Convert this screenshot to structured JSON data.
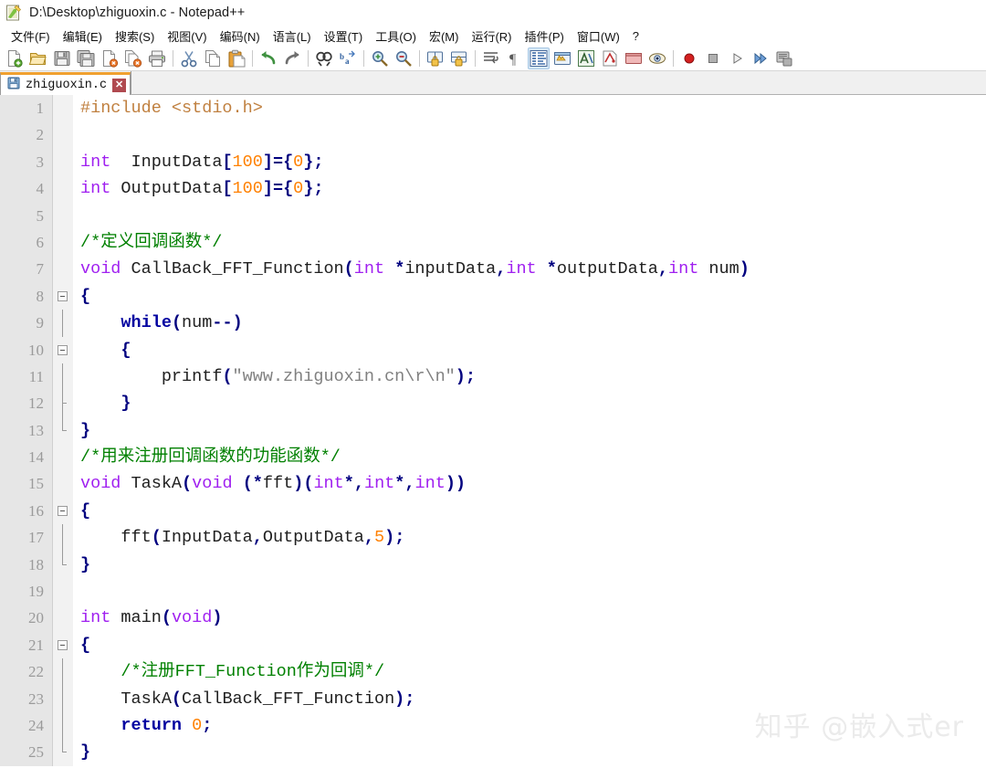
{
  "window": {
    "title": "D:\\Desktop\\zhiguoxin.c - Notepad++",
    "app_icon": "notepad-plus-plus-icon"
  },
  "menubar": {
    "items": [
      {
        "label": "文件(F)",
        "name": "menu-file"
      },
      {
        "label": "编辑(E)",
        "name": "menu-edit"
      },
      {
        "label": "搜索(S)",
        "name": "menu-search"
      },
      {
        "label": "视图(V)",
        "name": "menu-view"
      },
      {
        "label": "编码(N)",
        "name": "menu-encoding"
      },
      {
        "label": "语言(L)",
        "name": "menu-language"
      },
      {
        "label": "设置(T)",
        "name": "menu-settings"
      },
      {
        "label": "工具(O)",
        "name": "menu-tools"
      },
      {
        "label": "宏(M)",
        "name": "menu-macro"
      },
      {
        "label": "运行(R)",
        "name": "menu-run"
      },
      {
        "label": "插件(P)",
        "name": "menu-plugins"
      },
      {
        "label": "窗口(W)",
        "name": "menu-window"
      },
      {
        "label": "?",
        "name": "menu-help"
      }
    ]
  },
  "toolbar": {
    "buttons": [
      "new-file-icon",
      "open-file-icon",
      "save-icon",
      "save-all-icon",
      "close-file-icon",
      "close-all-icon",
      "print-icon",
      "sep",
      "cut-icon",
      "copy-icon",
      "paste-icon",
      "sep",
      "undo-icon",
      "redo-icon",
      "sep",
      "find-icon",
      "replace-icon",
      "sep",
      "zoom-in-icon",
      "zoom-out-icon",
      "sep",
      "sync-vertical-scroll-icon",
      "sync-horizontal-scroll-icon",
      "sep",
      "word-wrap-icon",
      "show-all-characters-icon",
      "indent-guide-icon",
      "user-defined-dialog-icon",
      "show-function-list-icon",
      "document-map-icon",
      "folder-as-workspace-icon",
      "monitoring-icon",
      "sep",
      "macro-record-icon",
      "macro-stop-icon",
      "macro-playback-icon",
      "macro-run-multiple-icon",
      "macro-save-icon"
    ]
  },
  "tab": {
    "label": "zhiguoxin.c",
    "save_icon": "floppy-disk-saved-icon",
    "close_label": "✕"
  },
  "editor": {
    "first_line": 1,
    "last_line": 25,
    "lines": [
      {
        "n": "1",
        "fold": "none"
      },
      {
        "n": "2",
        "fold": "none"
      },
      {
        "n": "3",
        "fold": "none"
      },
      {
        "n": "4",
        "fold": "none"
      },
      {
        "n": "5",
        "fold": "none"
      },
      {
        "n": "6",
        "fold": "none"
      },
      {
        "n": "7",
        "fold": "none"
      },
      {
        "n": "8",
        "fold": "open"
      },
      {
        "n": "9",
        "fold": "line"
      },
      {
        "n": "10",
        "fold": "open"
      },
      {
        "n": "11",
        "fold": "line"
      },
      {
        "n": "12",
        "fold": "tick"
      },
      {
        "n": "13",
        "fold": "end"
      },
      {
        "n": "14",
        "fold": "none"
      },
      {
        "n": "15",
        "fold": "none"
      },
      {
        "n": "16",
        "fold": "open"
      },
      {
        "n": "17",
        "fold": "line"
      },
      {
        "n": "18",
        "fold": "end"
      },
      {
        "n": "19",
        "fold": "none"
      },
      {
        "n": "20",
        "fold": "none"
      },
      {
        "n": "21",
        "fold": "open"
      },
      {
        "n": "22",
        "fold": "line"
      },
      {
        "n": "23",
        "fold": "line"
      },
      {
        "n": "24",
        "fold": "line"
      },
      {
        "n": "25",
        "fold": "end"
      }
    ],
    "code": [
      [
        {
          "t": "#include ",
          "c": "pp"
        },
        {
          "t": "<stdio.h>",
          "c": "pp"
        }
      ],
      [],
      [
        {
          "t": "int",
          "c": "k"
        },
        {
          "t": "  InputData",
          "c": "id"
        },
        {
          "t": "[",
          "c": "op"
        },
        {
          "t": "100",
          "c": "num"
        },
        {
          "t": "]={",
          "c": "op"
        },
        {
          "t": "0",
          "c": "num"
        },
        {
          "t": "};",
          "c": "op"
        }
      ],
      [
        {
          "t": "int",
          "c": "k"
        },
        {
          "t": " OutputData",
          "c": "id"
        },
        {
          "t": "[",
          "c": "op"
        },
        {
          "t": "100",
          "c": "num"
        },
        {
          "t": "]={",
          "c": "op"
        },
        {
          "t": "0",
          "c": "num"
        },
        {
          "t": "};",
          "c": "op"
        }
      ],
      [],
      [
        {
          "t": "/*定义回调函数*/",
          "c": "cm"
        }
      ],
      [
        {
          "t": "void",
          "c": "k"
        },
        {
          "t": " CallBack_FFT_Function",
          "c": "id"
        },
        {
          "t": "(",
          "c": "op"
        },
        {
          "t": "int",
          "c": "k"
        },
        {
          "t": " ",
          "c": "id"
        },
        {
          "t": "*",
          "c": "op"
        },
        {
          "t": "inputData",
          "c": "id"
        },
        {
          "t": ",",
          "c": "op"
        },
        {
          "t": "int",
          "c": "k"
        },
        {
          "t": " ",
          "c": "id"
        },
        {
          "t": "*",
          "c": "op"
        },
        {
          "t": "outputData",
          "c": "id"
        },
        {
          "t": ",",
          "c": "op"
        },
        {
          "t": "int",
          "c": "k"
        },
        {
          "t": " num",
          "c": "id"
        },
        {
          "t": ")",
          "c": "op"
        }
      ],
      [
        {
          "t": "{",
          "c": "op"
        }
      ],
      [
        {
          "t": "    ",
          "c": "id"
        },
        {
          "t": "while",
          "c": "kb"
        },
        {
          "t": "(",
          "c": "op"
        },
        {
          "t": "num",
          "c": "id"
        },
        {
          "t": "--)",
          "c": "op"
        }
      ],
      [
        {
          "t": "    ",
          "c": "id"
        },
        {
          "t": "{",
          "c": "op"
        }
      ],
      [
        {
          "t": "        printf",
          "c": "id"
        },
        {
          "t": "(",
          "c": "op"
        },
        {
          "t": "\"www.zhiguoxin.cn\\r\\n\"",
          "c": "str"
        },
        {
          "t": ");",
          "c": "op"
        }
      ],
      [
        {
          "t": "    ",
          "c": "id"
        },
        {
          "t": "}",
          "c": "op"
        }
      ],
      [
        {
          "t": "}",
          "c": "op"
        }
      ],
      [
        {
          "t": "/*用来注册回调函数的功能函数*/",
          "c": "cm"
        }
      ],
      [
        {
          "t": "void",
          "c": "k"
        },
        {
          "t": " TaskA",
          "c": "id"
        },
        {
          "t": "(",
          "c": "op"
        },
        {
          "t": "void",
          "c": "k"
        },
        {
          "t": " ",
          "c": "id"
        },
        {
          "t": "(*",
          "c": "op"
        },
        {
          "t": "fft",
          "c": "id"
        },
        {
          "t": ")(",
          "c": "op"
        },
        {
          "t": "int",
          "c": "k"
        },
        {
          "t": "*,",
          "c": "op"
        },
        {
          "t": "int",
          "c": "k"
        },
        {
          "t": "*,",
          "c": "op"
        },
        {
          "t": "int",
          "c": "k"
        },
        {
          "t": "))",
          "c": "op"
        }
      ],
      [
        {
          "t": "{",
          "c": "op"
        }
      ],
      [
        {
          "t": "    fft",
          "c": "id"
        },
        {
          "t": "(",
          "c": "op"
        },
        {
          "t": "InputData",
          "c": "id"
        },
        {
          "t": ",",
          "c": "op"
        },
        {
          "t": "OutputData",
          "c": "id"
        },
        {
          "t": ",",
          "c": "op"
        },
        {
          "t": "5",
          "c": "num"
        },
        {
          "t": ");",
          "c": "op"
        }
      ],
      [
        {
          "t": "}",
          "c": "op"
        }
      ],
      [],
      [
        {
          "t": "int",
          "c": "k"
        },
        {
          "t": " main",
          "c": "id"
        },
        {
          "t": "(",
          "c": "op"
        },
        {
          "t": "void",
          "c": "k"
        },
        {
          "t": ")",
          "c": "op"
        }
      ],
      [
        {
          "t": "{",
          "c": "op"
        }
      ],
      [
        {
          "t": "    ",
          "c": "id"
        },
        {
          "t": "/*注册FFT_Function作为回调*/",
          "c": "cm"
        }
      ],
      [
        {
          "t": "    TaskA",
          "c": "id"
        },
        {
          "t": "(",
          "c": "op"
        },
        {
          "t": "CallBack_FFT_Function",
          "c": "id"
        },
        {
          "t": ");",
          "c": "op"
        }
      ],
      [
        {
          "t": "    ",
          "c": "id"
        },
        {
          "t": "return",
          "c": "kb"
        },
        {
          "t": " ",
          "c": "id"
        },
        {
          "t": "0",
          "c": "num"
        },
        {
          "t": ";",
          "c": "op"
        }
      ],
      [
        {
          "t": "}",
          "c": "op"
        }
      ]
    ]
  },
  "watermark": {
    "text": "知乎 @嵌入式er"
  },
  "colors": {
    "keyword_type": "#a020f0",
    "keyword_flow": "#0000a0",
    "operator": "#00007f",
    "number": "#ff8000",
    "string": "#808080",
    "comment": "#008000",
    "preprocessor": "#c08040",
    "identifier": "#202020",
    "tab_active_top": "#f0a030",
    "gutter_bg": "#e6e6e6",
    "editor_bg": "#ffffff"
  }
}
